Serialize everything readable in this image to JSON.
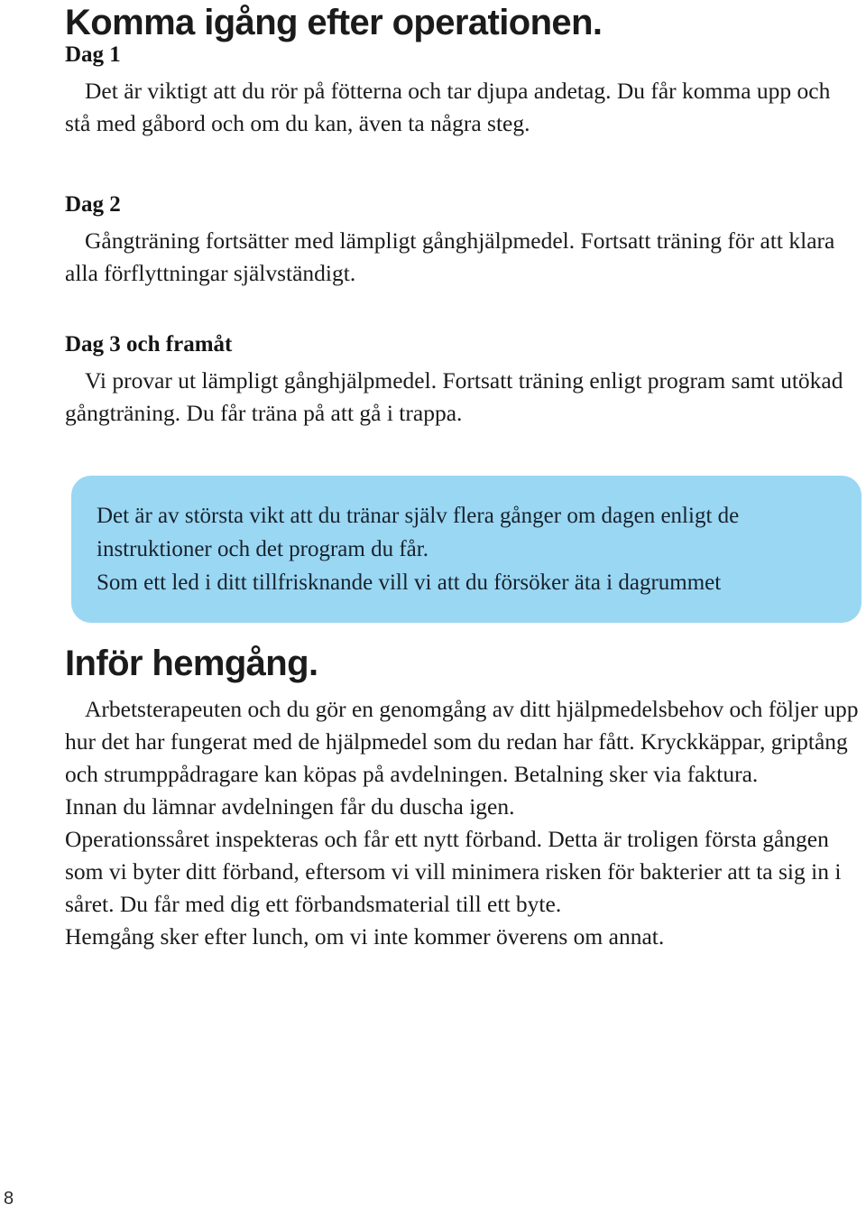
{
  "document": {
    "page_number": "8",
    "accent_color": "#9ad7f3",
    "text_color": "#1b1b1b"
  },
  "heading_main": "Komma igång efter operationen.",
  "sections": [
    {
      "label": "Dag 1",
      "body": "Det är viktigt att du rör på fötterna och tar djupa andetag. Du får komma upp och stå med gåbord och om du kan, även ta några steg."
    },
    {
      "label": "Dag 2",
      "body": "Gångträning fortsätter med lämpligt gånghjälpmedel. Fortsatt träning för att klara alla förflyttningar självständigt."
    },
    {
      "label": "Dag 3 och framåt",
      "body": "Vi provar ut lämpligt gånghjälpmedel. Fortsatt träning enligt program samt utökad gångträning. Du får träna på att gå i trappa."
    }
  ],
  "callout": {
    "line1": "Det är av största vikt att du tränar själv flera gånger om dagen enligt de instruktioner och det program du får.",
    "line2": "Som ett led i ditt tillfrisknande vill vi att du försöker äta i dagrummet"
  },
  "heading_second": "Inför hemgång.",
  "closing": {
    "paragraph1": "Arbetsterapeuten och du gör en genomgång av ditt hjälpmedelsbehov och följer upp hur det har fungerat med de hjälpmedel som du redan har fått. Kryckkäppar, griptång och strumppådragare kan köpas på avdelningen. Betalning sker via faktura.",
    "paragraph2": "Innan du lämnar avdelningen får du duscha igen.",
    "paragraph3": "Operationssåret inspekteras och får ett nytt förband. Detta är troligen första gången som vi byter ditt förband, eftersom vi vill minimera risken för bakterier att ta sig in i såret. Du får med dig ett förbandsmaterial till ett byte.",
    "paragraph4": "Hemgång sker efter lunch, om vi inte kommer överens om annat."
  }
}
